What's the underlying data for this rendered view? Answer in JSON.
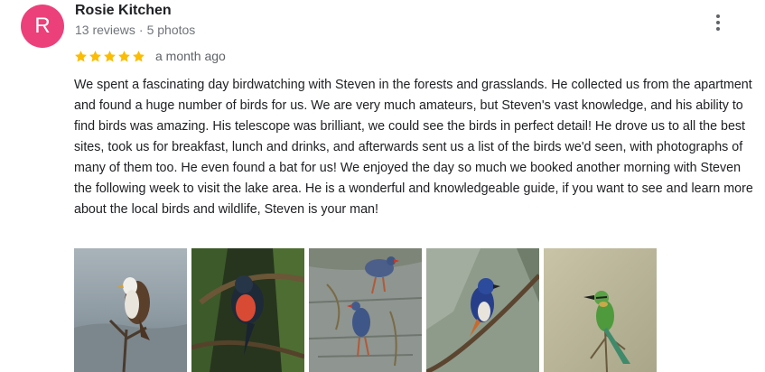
{
  "reviewer": {
    "avatar_letter": "R",
    "avatar_color": "#ec407a",
    "name": "Rosie Kitchen",
    "reviews_count": "13 reviews",
    "separator": "·",
    "photos_count": "5 photos"
  },
  "rating": {
    "stars": 5,
    "max": 5,
    "star_color": "#fbbc04"
  },
  "posted": "a month ago",
  "review_text": "We spent a fascinating day birdwatching with Steven in the forests and grasslands. He collected us from the apartment and found a huge number of birds for us. We are very much amateurs, but Steven's vast knowledge, and his ability to find birds was amazing. His telescope was brilliant, we could see the birds in perfect detail! He drove us to all the best sites, took us for breakfast, lunch and drinks, and afterwards sent us a list of the birds we'd seen, with photographs of many of them too. He even found a bat for us! We enjoyed the day so much we booked another morning with Steven the following week to visit the lake area. He is a wonderful and knowledgeable guide, if you want to see and learn more about the local birds and wildlife, Steven is your man!",
  "photos": [
    {
      "subject": "eagle-on-branch"
    },
    {
      "subject": "red-breasted-bird-in-forest"
    },
    {
      "subject": "purple-swamphens-in-water"
    },
    {
      "subject": "blue-bird-on-branch"
    },
    {
      "subject": "bee-eater-on-twig"
    }
  ],
  "icons": {
    "more": "more-vert-icon",
    "star": "star-icon"
  }
}
